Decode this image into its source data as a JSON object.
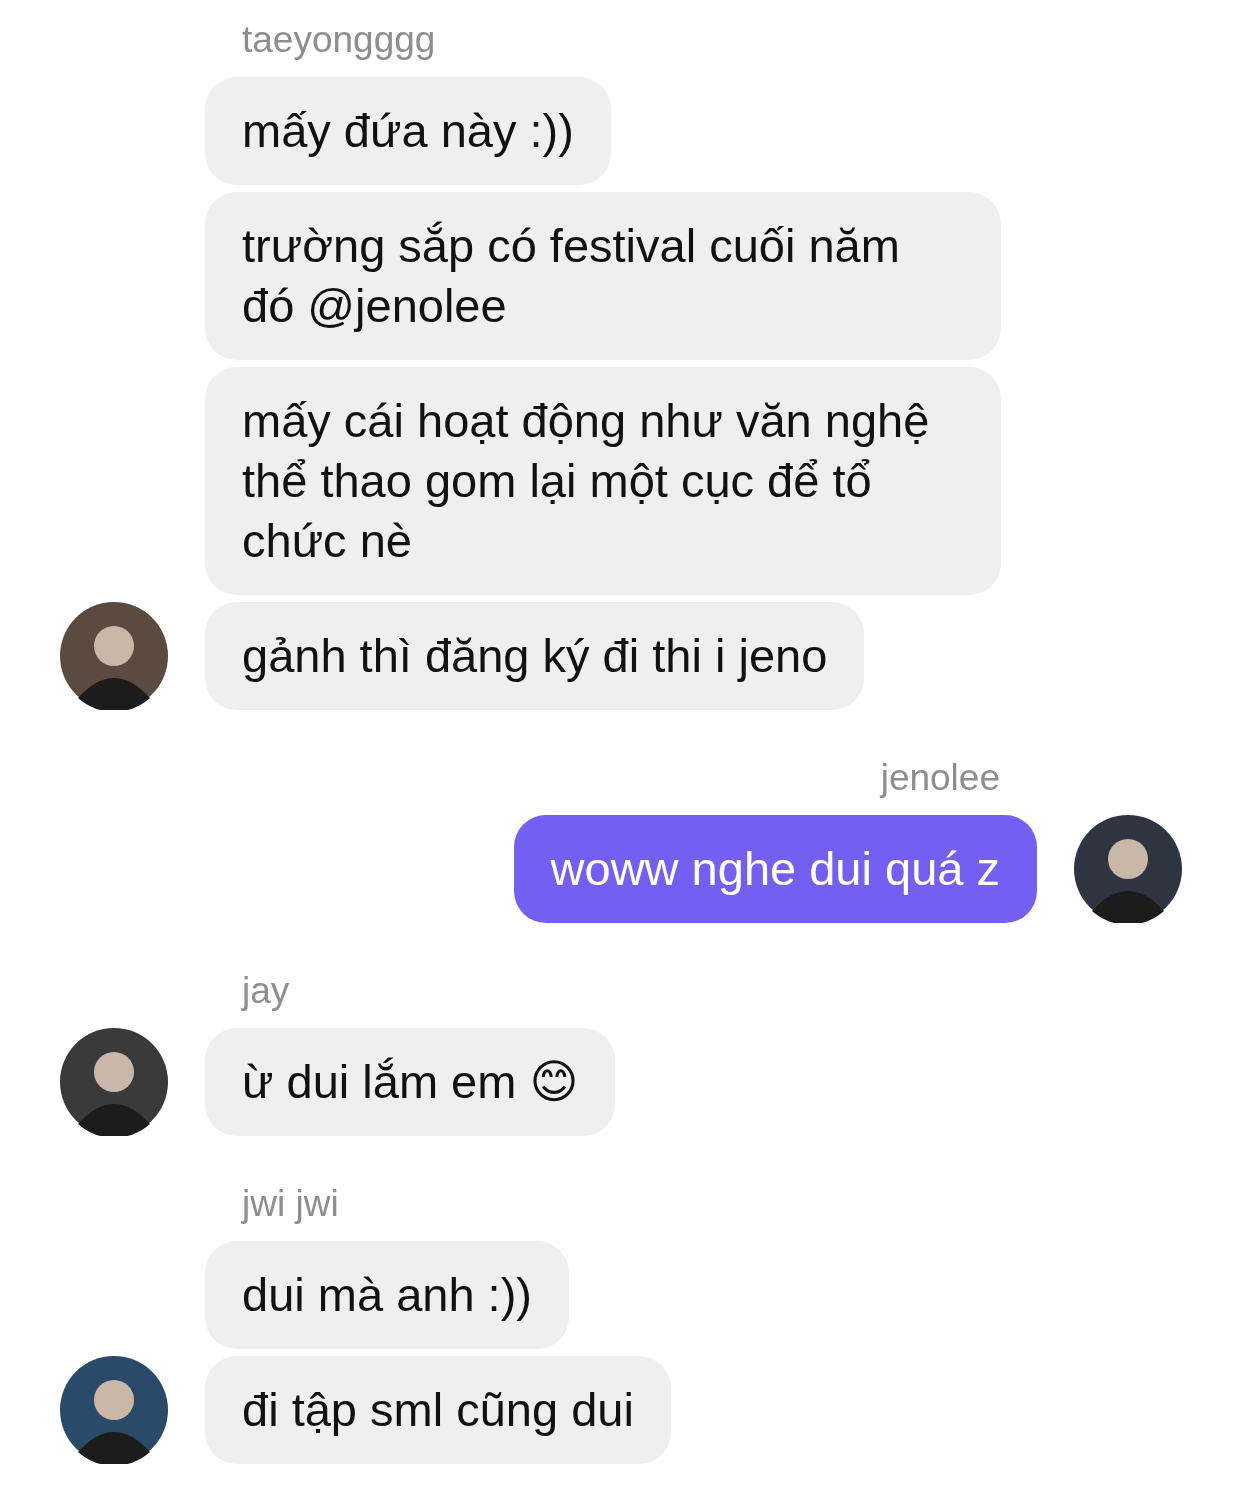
{
  "messages": [
    {
      "sender": "taeyongggg",
      "kind": "incoming",
      "texts": [
        "mấy đứa này :))",
        "trường sắp có festival cuối năm đó @jenolee",
        "mấy cái hoạt động như văn nghệ thể thao gom lại một cục để tổ chức nè",
        "gảnh thì đăng ký đi thi i jeno"
      ]
    },
    {
      "sender": "jenolee",
      "kind": "outgoing",
      "texts": [
        "woww nghe dui quá z"
      ]
    },
    {
      "sender": "jay",
      "kind": "incoming",
      "texts": [
        "ừ dui lắm em 😊"
      ]
    },
    {
      "sender": "jwi jwi",
      "kind": "incoming",
      "texts": [
        "dui mà anh :))",
        "đi tập sml cũng dui"
      ]
    }
  ]
}
